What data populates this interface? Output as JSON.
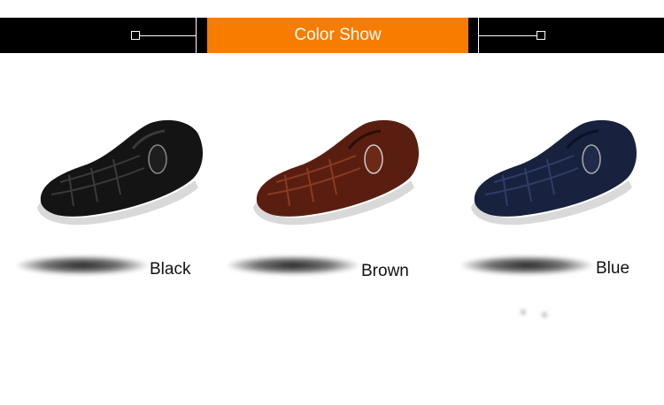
{
  "header": {
    "title": "Color Show"
  },
  "colors": {
    "banner": "#000000",
    "accent": "#f77c00"
  },
  "products": [
    {
      "label": "Black",
      "shoe_color": "#141414",
      "shoe_highlight": "#3a3a3a",
      "icon": "shoe-black-icon"
    },
    {
      "label": "Brown",
      "shoe_color": "#5a1e10",
      "shoe_highlight": "#8a3a22",
      "icon": "shoe-brown-icon"
    },
    {
      "label": "Blue",
      "shoe_color": "#18213e",
      "shoe_highlight": "#2f3c68",
      "icon": "shoe-blue-icon"
    }
  ]
}
